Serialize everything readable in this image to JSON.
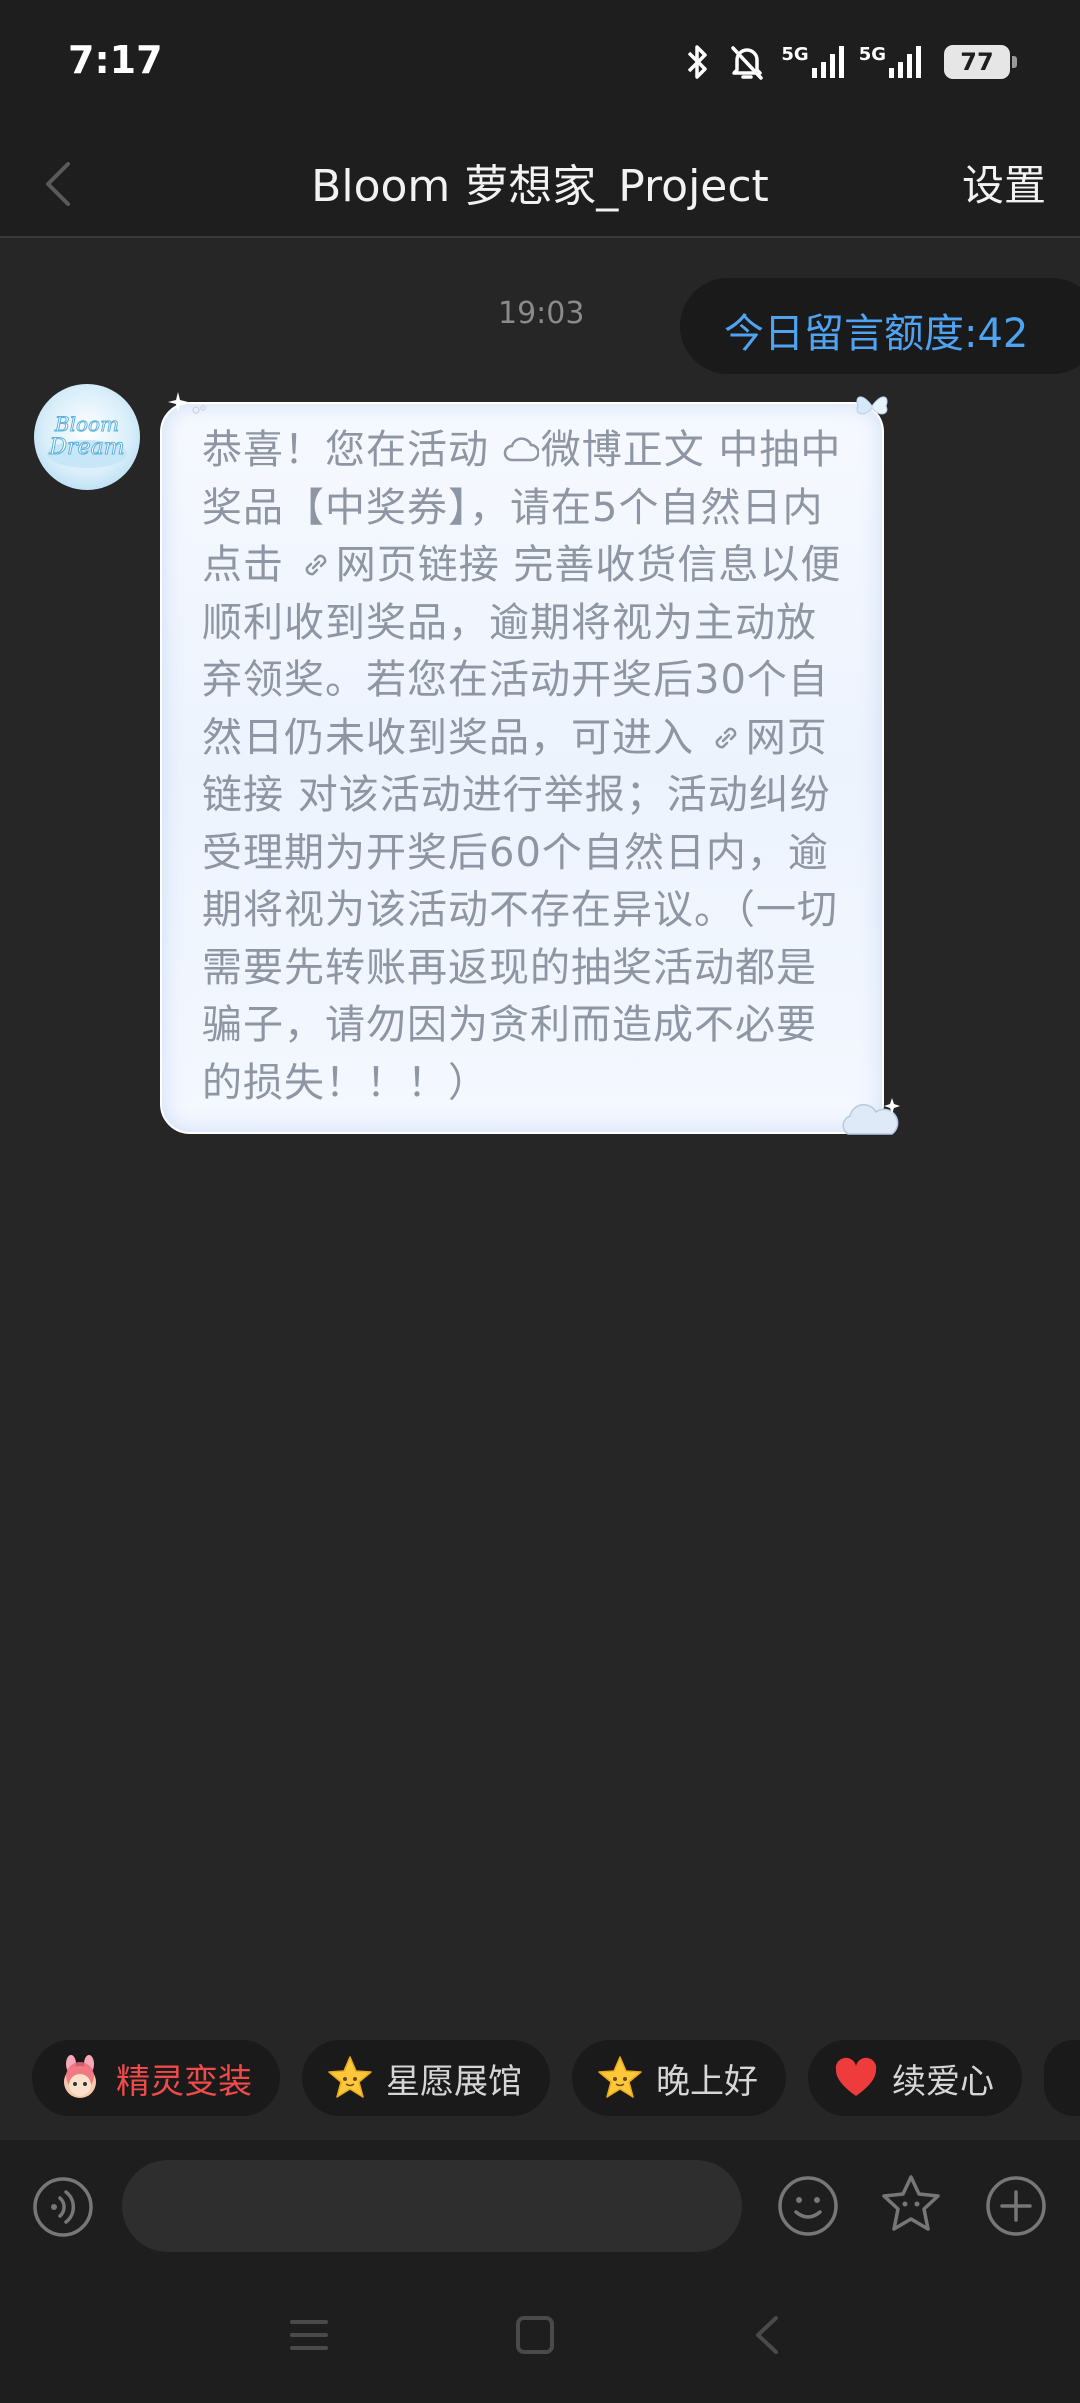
{
  "status_bar": {
    "time": "7:17",
    "network_1": "5G",
    "network_2": "5G",
    "battery": "77"
  },
  "header": {
    "title": "Bloom 萝想家_Project",
    "settings_label": "设置"
  },
  "chat": {
    "timestamp": "19:03",
    "quota_label": "今日留言额度:42",
    "sender_avatar_text": "Bloom Dream",
    "message": {
      "part1": "恭喜！您在活动 ",
      "link1": "微博正文",
      "part2": "  中抽中奖品【中奖券】，请在5个自然日内点击 ",
      "link2": "网页链接",
      "part3": "  完善收货信息以便顺利收到奖品，逾期将视为主动放弃领奖。若您在活动开奖后30个自然日仍未收到奖品，可进入 ",
      "link3": "网页链接",
      "part4": "  对该活动进行举报；活动纠纷受理期为开奖后60个自然日内，逾期将视为该活动不存在异议。（一切需要先转账再返现的抽奖活动都是骗子，请勿因为贪利而造成不必要的损失！！！）"
    }
  },
  "quick_chips": [
    {
      "label": "精灵变装",
      "icon": "pink-bunny-icon"
    },
    {
      "label": "星愿展馆",
      "icon": "star-face-icon"
    },
    {
      "label": "晚上好",
      "icon": "star-face-icon"
    },
    {
      "label": "续爱心",
      "icon": "red-heart-icon"
    }
  ],
  "input_bar": {
    "placeholder": ""
  },
  "colors": {
    "background": "#262626",
    "accent_blue": "#4fa3f0",
    "chip_red": "#f04a4a"
  }
}
